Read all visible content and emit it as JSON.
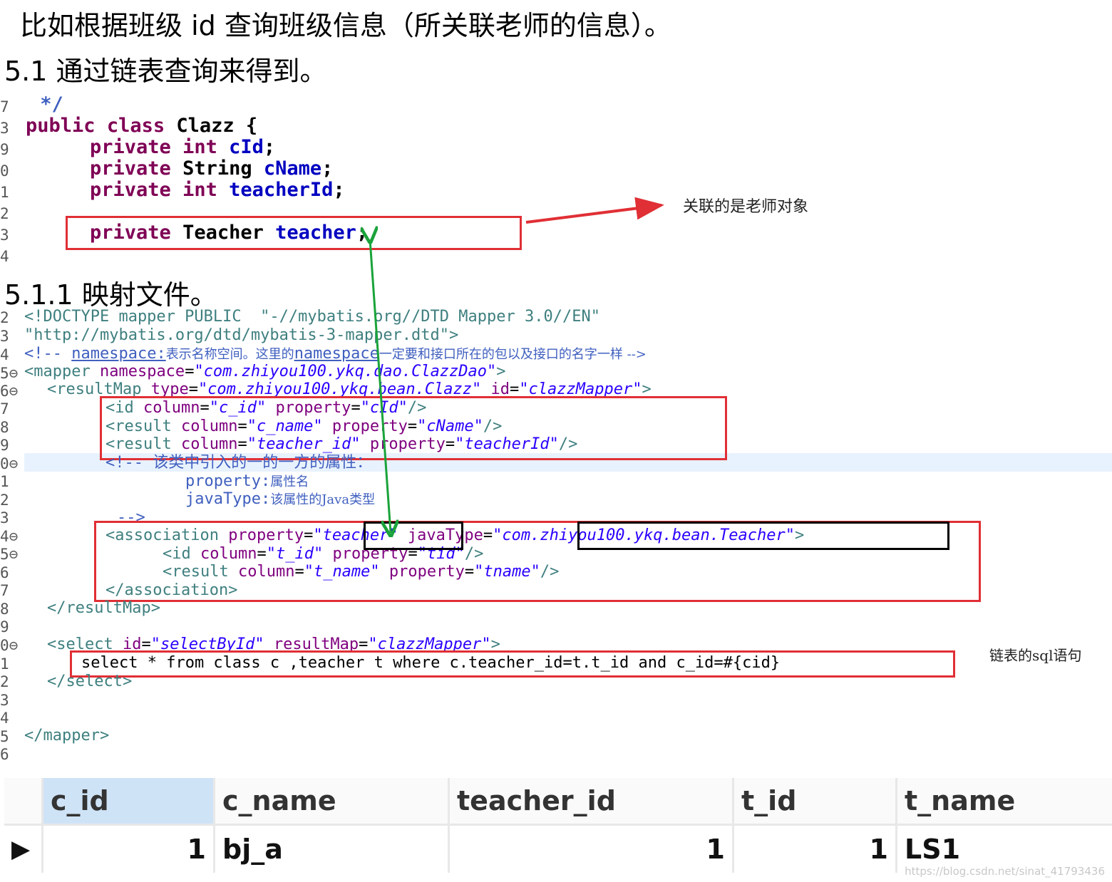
{
  "heading1": "比如根据班级 id 查询班级信息（所关联老师的信息）。",
  "heading2": "5.1  通过链表查询来得到。",
  "heading3": "5.1.1 映射文件。",
  "java": {
    "gutter": [
      "7",
      "3",
      "9",
      "0",
      "1",
      "2",
      "3",
      "4"
    ],
    "line1": " */",
    "kw_public": "public",
    "kw_class": "class",
    "class_name": "Clazz {",
    "kw_private": "private",
    "t_int": "int",
    "t_string": "String",
    "t_teacher": "Teacher",
    "f1": "cId",
    "f2": "cName",
    "f3": "teacherId",
    "f4": "teacher",
    "semi": ";"
  },
  "annotation_teacher": "关联的是老师对象",
  "annotation_sql": "链表的sql语句",
  "xml": {
    "gutter": [
      "2",
      "3",
      "4",
      "5⊖",
      "6⊖",
      "7",
      "8",
      "9",
      "0⊖",
      "1",
      "2",
      "3",
      "4⊖",
      "5⊖",
      "6",
      "7",
      "8",
      "9",
      "0⊖",
      "1",
      "2",
      "3",
      "4",
      "5",
      "6"
    ],
    "l2": "<!DOCTYPE mapper PUBLIC  \"-//mybatis.org//DTD Mapper 3.0//EN\"",
    "l3": "\"http://mybatis.org/dtd/mybatis-3-mapper.dtd\">",
    "l4a": "<!-- ",
    "l4b": "namespace:",
    "l4c": "表示名称空间。这里的",
    "l4d": "namespace",
    "l4e": "一定要和接口所在的包以及接口的名字一样 -->",
    "mapper_open": "<mapper",
    "ns_attr": "namespace",
    "ns_val": "\"com.zhiyou100.ykq.dao.ClazzDao\"",
    "rm_open": "<resultMap",
    "type_attr": "type",
    "type_val": "\"com.zhiyou100.ykq.bean.Clazz\"",
    "id_attr": "id",
    "rm_id_val": "\"clazzMapper\"",
    "id_tag": "<id",
    "result_tag": "<result",
    "column_attr": "column",
    "property_attr": "property",
    "c1": "\"c_id\"",
    "p1": "\"cId\"",
    "c2": "\"c_name\"",
    "p2": "\"cName\"",
    "c3": "\"teacher_id\"",
    "p3": "\"teacherId\"",
    "cmt1": "<!-- 该类中引入的一的一方的属性：",
    "cmt2a": "property:",
    "cmt2b": "属性名",
    "cmt3a": "javaType:",
    "cmt3b": "该属性的Java类型",
    "cmt4": "-->",
    "assoc_open": "<association",
    "assoc_prop_val": "\"teacher\"",
    "javatype_attr": "javaType",
    "javatype_val": "\"com.zhiyou100.ykq.bean.Teacher\"",
    "c4": "\"t_id\"",
    "p4": "\"tid\"",
    "c5": "\"t_name\"",
    "p5": "\"tname\"",
    "assoc_close": "</association>",
    "rm_close": "</resultMap>",
    "select_open": "<select",
    "select_id_val": "\"selectById\"",
    "resultmap_attr": "resultMap",
    "select_rm_val": "\"clazzMapper\"",
    "sql": "select * from class c ,teacher t where c.teacher_id=t.t_id and c_id=#{cid}",
    "select_close": "</select>",
    "mapper_close": "</mapper>",
    "eq": "=",
    "selfclose": "/>",
    "gt": ">"
  },
  "result_table": {
    "columns": [
      "c_id",
      "c_name",
      "teacher_id",
      "t_id",
      "t_name"
    ],
    "row": [
      "1",
      "bj_a",
      "1",
      "1",
      "LS1"
    ]
  },
  "watermark": "https://blog.csdn.net/sinat_41793436"
}
